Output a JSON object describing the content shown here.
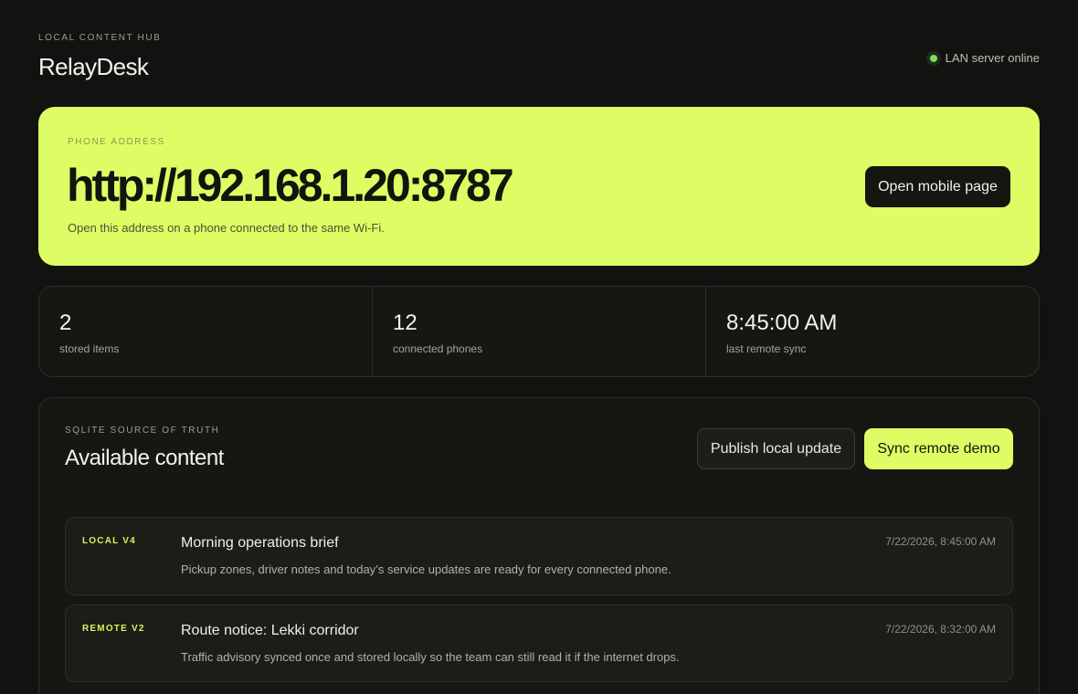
{
  "header": {
    "eyebrow": "LOCAL CONTENT HUB",
    "title": "RelayDesk",
    "status": "LAN server online",
    "status_color": "#7fdc5c"
  },
  "hero": {
    "label": "PHONE ADDRESS",
    "address": "http://192.168.1.20:8787",
    "hint": "Open this address on a phone connected to the same Wi-Fi.",
    "button": "Open mobile page",
    "accent_color": "#defd65"
  },
  "stats": [
    {
      "value": "2",
      "label": "stored items"
    },
    {
      "value": "12",
      "label": "connected phones"
    },
    {
      "value": "8:45:00 AM",
      "label": "last remote sync"
    }
  ],
  "content": {
    "eyebrow": "SQLITE SOURCE OF TRUTH",
    "title": "Available content",
    "publish_button": "Publish local update",
    "sync_button": "Sync remote demo",
    "items": [
      {
        "tag": "LOCAL V4",
        "title": "Morning operations brief",
        "description": "Pickup zones, driver notes and today’s service updates are ready for every connected phone.",
        "timestamp": "7/22/2026, 8:45:00 AM"
      },
      {
        "tag": "REMOTE V2",
        "title": "Route notice: Lekki corridor",
        "description": "Traffic advisory synced once and stored locally so the team can still read it if the internet drops.",
        "timestamp": "7/22/2026, 8:32:00 AM"
      }
    ]
  }
}
